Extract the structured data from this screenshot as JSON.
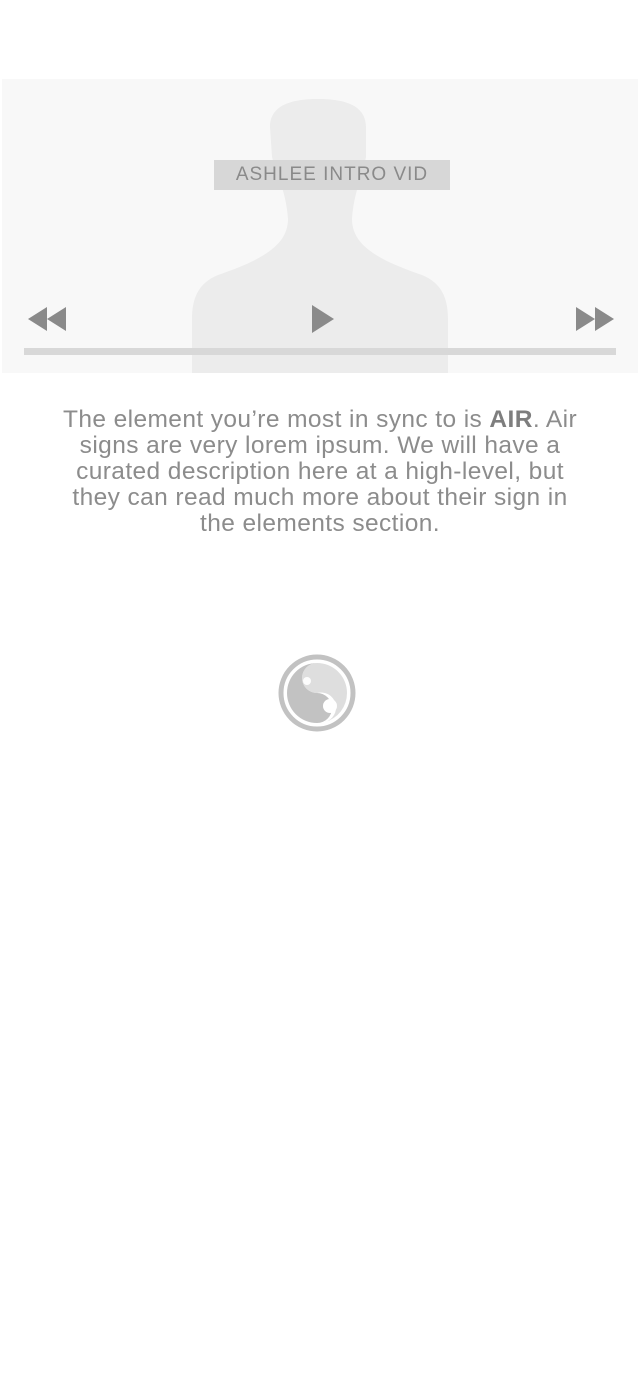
{
  "video": {
    "label": "ASHLEE INTRO VID",
    "controls": {
      "rewind_icon": "rewind-icon",
      "play_icon": "play-icon",
      "fast_forward_icon": "fast-forward-icon"
    },
    "progress": 0
  },
  "description": {
    "before": "The element you’re most in sync to is ",
    "element": "AIR",
    "after": ". Air signs are very lorem ipsum. We will have a curated description here at a high-level, but they can read much more about their sign in the elements section."
  },
  "logo": {
    "icon": "swirl-logo-icon"
  },
  "colors": {
    "text": "#8c8c8c",
    "video_bg": "#f8f8f8",
    "silhouette": "#ececec",
    "label_bg": "#d7d7d7",
    "controls": "#8a8a8a",
    "logo": "#c2c2c2"
  }
}
